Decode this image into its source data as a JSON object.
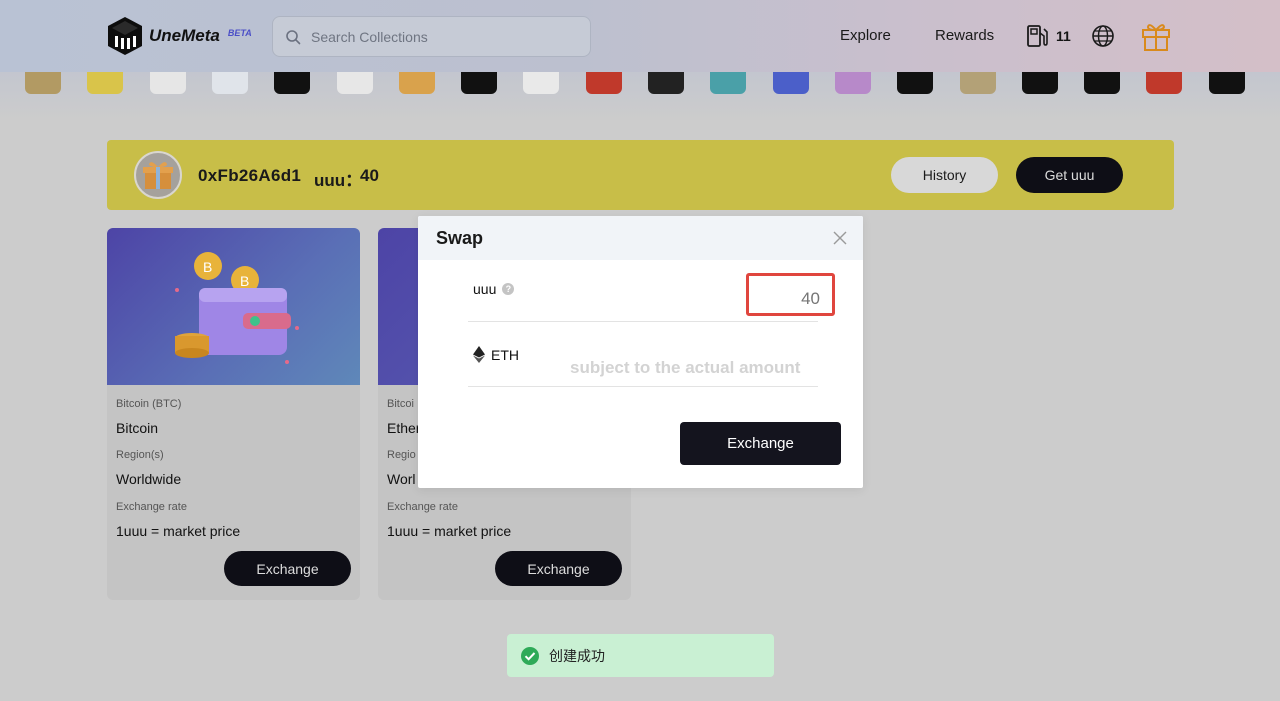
{
  "header": {
    "logo_text": "UneMeta",
    "logo_badge": "BETA",
    "search": {
      "placeholder": "Search Collections",
      "value": ""
    },
    "nav": {
      "explore": "Explore",
      "rewards": "Rewards"
    },
    "gas_count": "11"
  },
  "strip": {
    "thumb_colors": [
      "#b29a63",
      "#d9c44a",
      "#e6e6e6",
      "#e0e4ea",
      "#111111",
      "#e7e7e7",
      "#d9a24c",
      "#111111",
      "#e9e9e9",
      "#c0392b",
      "#222222",
      "#4aa0a8",
      "#4b5fc9",
      "#b789c9",
      "#111111",
      "#b3a177",
      "#111111",
      "#111111",
      "#c0392b",
      "#111111"
    ]
  },
  "banner": {
    "address": "0xFb26A6d1",
    "balance_label": "uuu：",
    "balance_value": "40",
    "history_button": "History",
    "get_button": "Get uuu"
  },
  "cards": [
    {
      "subtitle": "Bitcoin (BTC)",
      "name": "Bitcoin",
      "region_label": "Region(s)",
      "region": "Worldwide",
      "rate_label": "Exchange rate",
      "rate": "1uuu = market price",
      "button": "Exchange"
    },
    {
      "subtitle": "Bitcoi",
      "name": "Ether",
      "region_label": "Regio",
      "region": "Worl",
      "rate_label": "Exchange rate",
      "rate": "1uuu = market price",
      "button": "Exchange"
    }
  ],
  "modal": {
    "title": "Swap",
    "from_label": "uuu",
    "from_value": "",
    "from_placeholder": "40",
    "to_label": "ETH",
    "to_placeholder": "subject to the actual amount",
    "button": "Exchange"
  },
  "toast": {
    "message": "创建成功"
  },
  "colors": {
    "banner": "#c8be48",
    "primary_button": "#0e0e16",
    "highlight_border": "#e0463e",
    "toast_bg": "#c9f0d3",
    "toast_icon": "#2eaa58",
    "gift_icon": "#d98a1c"
  }
}
